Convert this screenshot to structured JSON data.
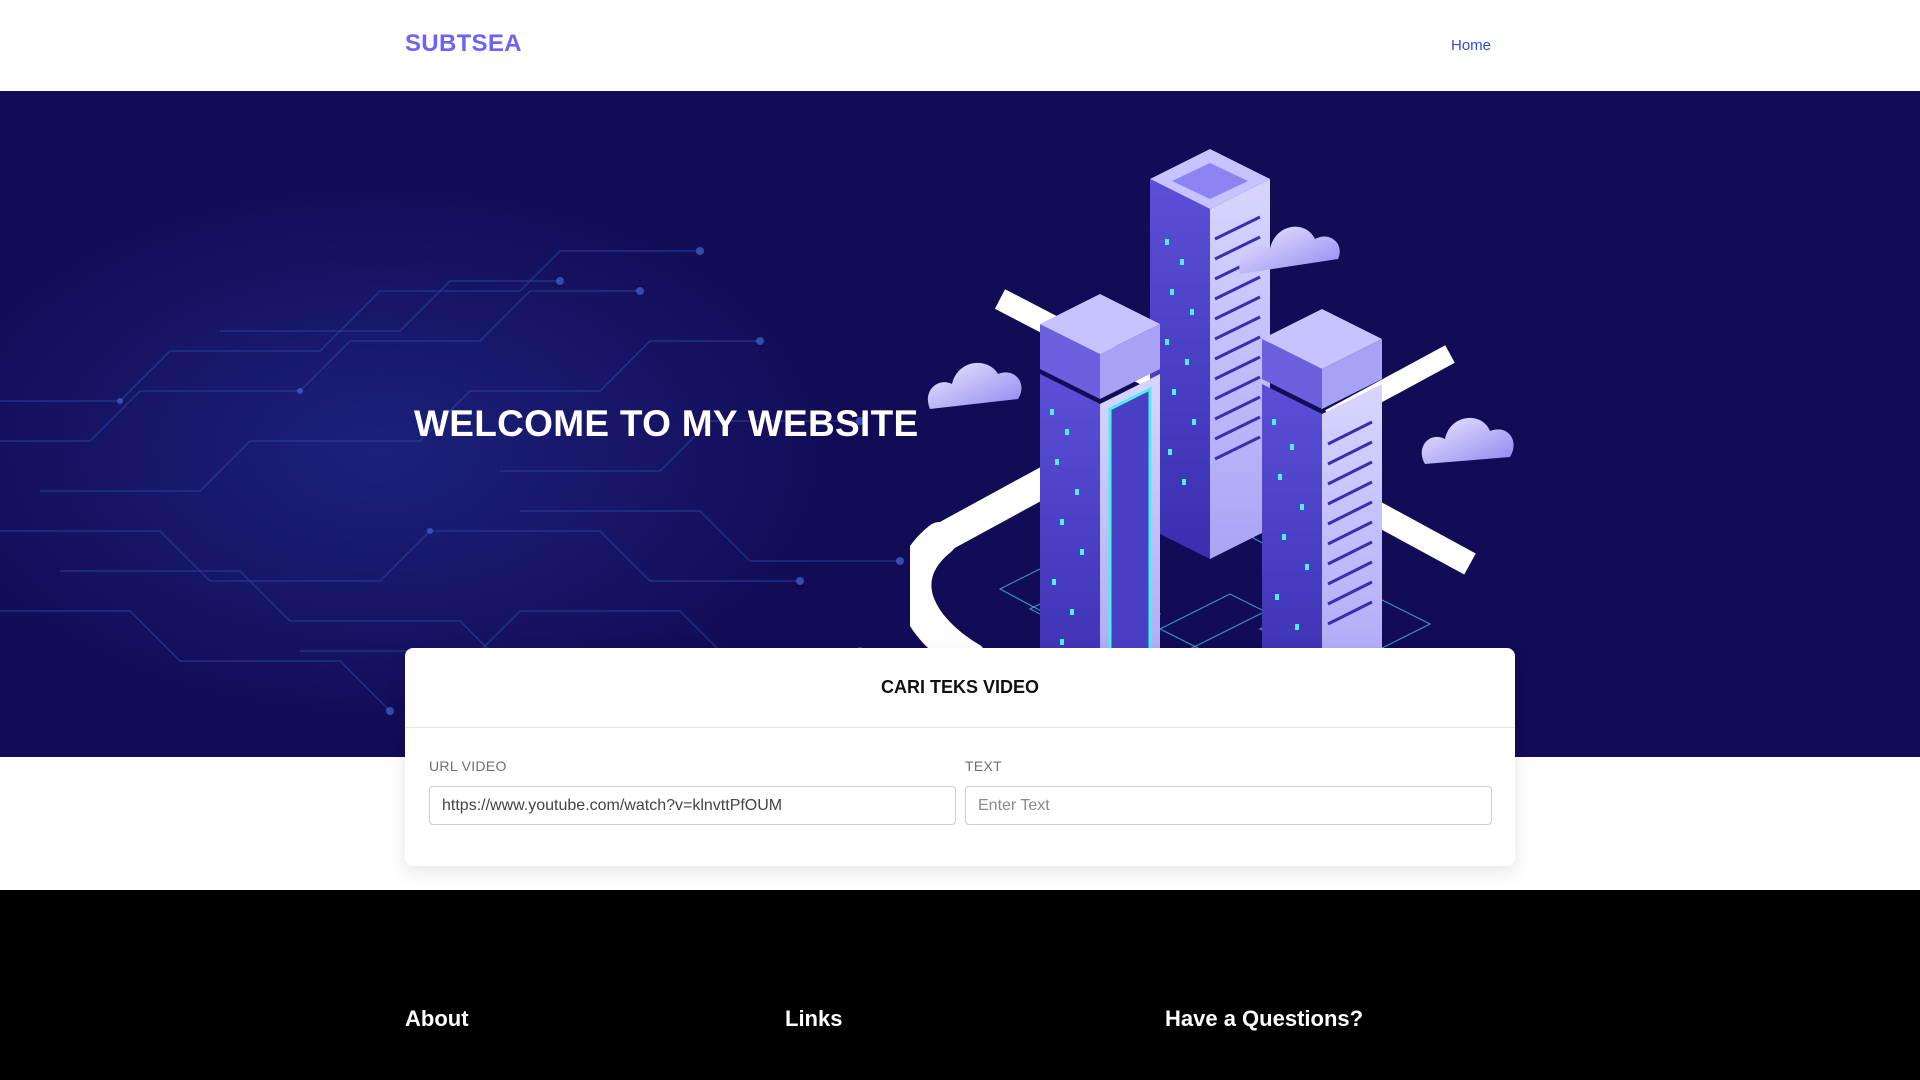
{
  "navbar": {
    "brand": "SUBTSEA",
    "links": [
      {
        "label": "Home"
      }
    ]
  },
  "hero": {
    "title": "WELCOME TO MY WEBSITE",
    "illustration": "isometric-city-illustration",
    "colors": {
      "background": "#120b55",
      "accent": "#6c63ff"
    }
  },
  "search_card": {
    "title": "CARI TEKS VIDEO",
    "url_field": {
      "label": "URL VIDEO",
      "value": "https://www.youtube.com/watch?v=klnvttPfOUM"
    },
    "text_field": {
      "label": "TEXT",
      "placeholder": "Enter Text"
    }
  },
  "footer": {
    "headings": [
      "About",
      "Links",
      "Have a Questions?"
    ]
  }
}
